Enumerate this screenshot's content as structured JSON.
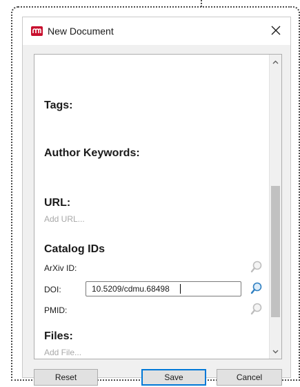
{
  "window": {
    "title": "New Document",
    "close_symbol": "✕",
    "logo_icon": "mendeley-logo",
    "accent": "#c8102e"
  },
  "form": {
    "tags_heading": "Tags:",
    "author_keywords_heading": "Author Keywords:",
    "url_heading": "URL:",
    "url_placeholder": "Add URL...",
    "catalog_ids_heading": "Catalog IDs",
    "arxiv_label": "ArXiv ID:",
    "doi_label": "DOI:",
    "doi_value": "10.5209/cdmu.68498",
    "pmid_label": "PMID:",
    "files_heading": "Files:",
    "files_placeholder": "Add File..."
  },
  "buttons": {
    "reset": "Reset",
    "save": "Save",
    "cancel": "Cancel"
  },
  "scrollbar": {
    "position": 0.55
  },
  "colors": {
    "focus_blue": "#0078d7",
    "lookup_active": "#2f7fc1",
    "lookup_inactive": "#bdbdbd"
  }
}
